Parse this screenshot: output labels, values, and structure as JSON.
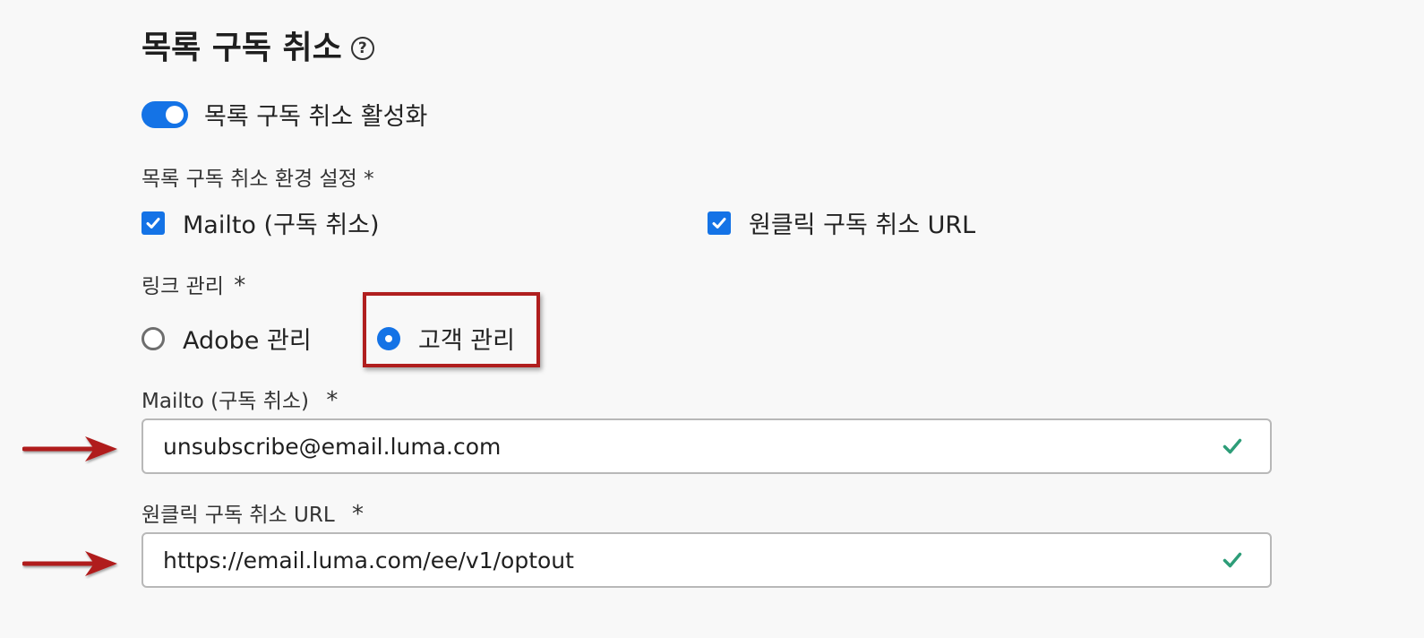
{
  "section": {
    "title": "목록 구독 취소",
    "help_icon": "help-circle-icon",
    "help_glyph": "?"
  },
  "toggle": {
    "label": "목록 구독 취소 활성화",
    "state": "on"
  },
  "preferences": {
    "label": "목록 구독 취소 환경 설정 *",
    "options": [
      {
        "label": "Mailto (구독 취소)",
        "checked": true
      },
      {
        "label": "원클릭 구독 취소 URL",
        "checked": true
      }
    ]
  },
  "link_management": {
    "label": "링크 관리",
    "required_mark": "*",
    "options": [
      {
        "label": "Adobe 관리",
        "selected": false
      },
      {
        "label": "고객 관리",
        "selected": true
      }
    ]
  },
  "mailto_field": {
    "label": "Mailto (구독 취소)",
    "required_mark": "*",
    "value": "unsubscribe@email.luma.com",
    "status_icon": "checkmark-icon"
  },
  "url_field": {
    "label": "원클릭 구독 취소 URL",
    "required_mark": "*",
    "value": "https://email.luma.com/ee/v1/optout",
    "status_icon": "checkmark-icon"
  },
  "colors": {
    "accent": "#1473e6",
    "valid": "#2d9d78",
    "annotation_red": "#b01e1e",
    "background": "#f8f8f8"
  }
}
